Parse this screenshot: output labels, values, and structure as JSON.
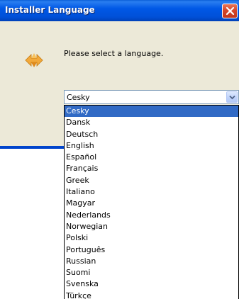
{
  "window": {
    "title": "Installer Language"
  },
  "dialog": {
    "prompt": "Please select a language."
  },
  "language_select": {
    "value": "Cesky",
    "options": [
      "Cesky",
      "Dansk",
      "Deutsch",
      "English",
      "Español",
      "Français",
      "Greek",
      "Italiano",
      "Magyar",
      "Nederlands",
      "Norwegian",
      "Polski",
      "Português",
      "Russian",
      "Suomi",
      "Svenska",
      "Türkçe"
    ],
    "selected_index": 0
  },
  "colors": {
    "titlebar": "#0058e6",
    "client_bg": "#ece9d8",
    "selection": "#316ac5",
    "close_button": "#d4452a"
  },
  "icons": {
    "app": "installer-arrows-icon",
    "close": "close-icon",
    "dropdown": "chevron-down-icon"
  }
}
